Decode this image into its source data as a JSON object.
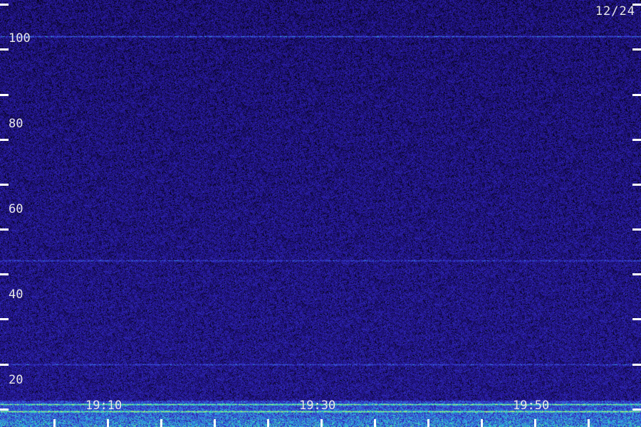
{
  "chart_data": {
    "type": "heatmap",
    "title": "",
    "date": "12/24",
    "xlabel": "",
    "ylabel": "",
    "x_tick_labels": [
      "19:10",
      "19:30",
      "19:50"
    ],
    "x_range_minutes": [
      "19:05",
      "19:64"
    ],
    "y_tick_labels": [
      "100",
      "80",
      "60",
      "40",
      "20"
    ],
    "ylim": [
      16,
      111
    ],
    "y_minor_step": 10,
    "x_minor_step_minutes": 5,
    "colormap": [
      "#000000",
      "#1a0f6a",
      "#2a1aa8",
      "#3a4ad8",
      "#2ab0e0",
      "#48e0a0",
      "#c8f060"
    ],
    "noise_floor_color": "#1a0f6a",
    "horizontal_lines": [
      {
        "y": 103,
        "intensity": "medium"
      },
      {
        "y": 53,
        "intensity": "low"
      },
      {
        "y": 30,
        "intensity": "low"
      },
      {
        "y": 21,
        "intensity": "high"
      },
      {
        "y": 19.5,
        "intensity": "high"
      }
    ],
    "strong_band_range": [
      16,
      22
    ],
    "grid": false,
    "legend": "none"
  }
}
